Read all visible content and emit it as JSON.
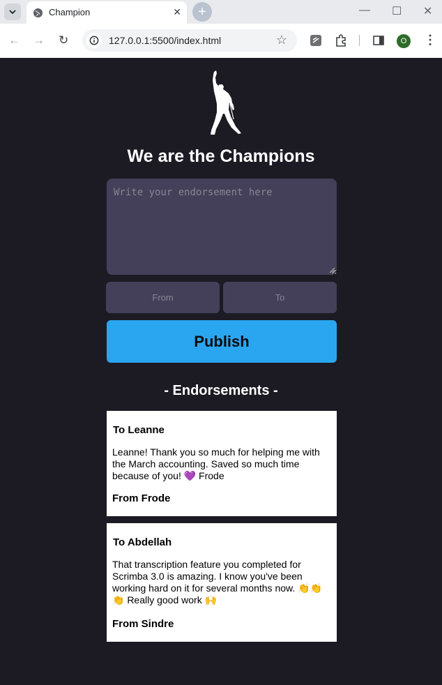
{
  "browser": {
    "tab_title": "Champion",
    "url": "127.0.0.1:5500/index.html",
    "profile_initial": "O"
  },
  "app": {
    "title": "We are the Champions",
    "textarea_placeholder": "Write your endorsement here",
    "from_placeholder": "From",
    "to_placeholder": "To",
    "publish_label": "Publish",
    "endorsements_heading": "- Endorsements -"
  },
  "endorsements": [
    {
      "to": "To Leanne",
      "message": "Leanne! Thank you so much for helping me with the March accounting. Saved so much time because of you! 💜 Frode",
      "from": "From Frode"
    },
    {
      "to": "To Abdellah",
      "message": "That transcription feature you completed for Scrimba 3.0 is amazing. I know you've been working hard on it for several months now. 👏👏👏 Really good work 🙌",
      "from": "From Sindre"
    }
  ],
  "colors": {
    "background": "#1c1b24",
    "input": "#444059",
    "accent": "#2aa6f0",
    "card": "#ffffff"
  }
}
